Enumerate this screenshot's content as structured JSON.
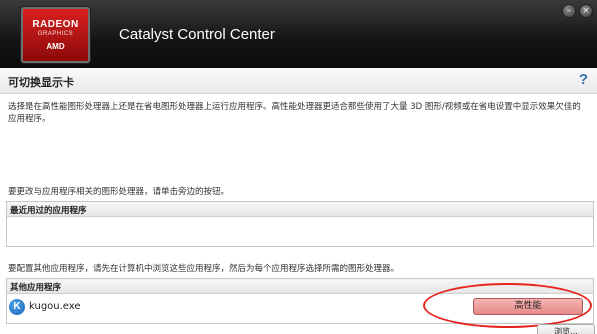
{
  "window": {
    "app_title": "Catalyst Control Center",
    "logo": {
      "line1": "RADEON",
      "line2": "GRAPHICS",
      "line3": "AMD"
    },
    "minimize_glyph": "–",
    "close_glyph": "×"
  },
  "page": {
    "title": "可切换显示卡",
    "help_glyph": "?"
  },
  "description": "选择是在高性能图形处理器上还是在省电图形处理器上运行应用程序。高性能处理器更适合那些使用了大量 3D 图形/视频或在省电设置中显示效果欠佳的应用程序。",
  "recent_instruction": "要更改与应用程序相关的图形处理器，请单击旁边的按钮。",
  "recent_group": {
    "header": "最近用过的应用程序"
  },
  "other_instruction": "要配置其他应用程序，请先在计算机中浏览这些应用程序，然后为每个应用程序选择所需的图形处理器。",
  "other_group": {
    "header": "其他应用程序",
    "apps": [
      {
        "icon_letter": "K",
        "name": "kugou.exe",
        "gpu_mode": "高性能"
      }
    ]
  },
  "browse_button": "浏览...",
  "colors": {
    "titlebar": "#141414",
    "logo_red": "#c41a1a",
    "gpu_button": "#f0a0a0",
    "highlight_ring": "#e5251e",
    "help": "#3a6fb4"
  }
}
